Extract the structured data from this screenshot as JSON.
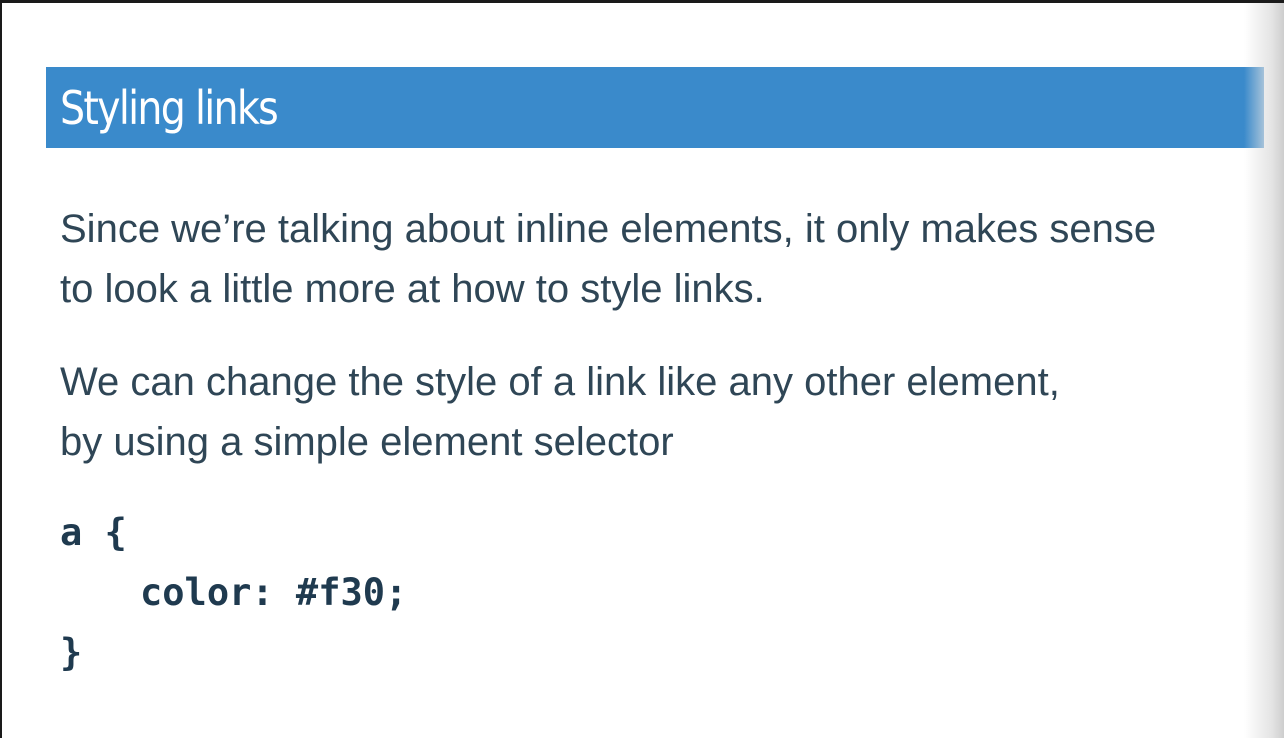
{
  "slide": {
    "title": "Styling links",
    "paragraphs": [
      {
        "lines": [
          "Since we’re talking about inline elements, it only makes sense",
          "to look a little more at how to style links."
        ]
      },
      {
        "lines": [
          "We can change the style of a link like any other element,",
          "by using a simple element selector"
        ]
      }
    ],
    "code": {
      "lines": [
        "a {",
        "color: #f30;",
        "}"
      ]
    }
  },
  "colors": {
    "title_bar": "#3a8acb",
    "body_text": "#2f4656",
    "code_text": "#1f3a4f"
  }
}
